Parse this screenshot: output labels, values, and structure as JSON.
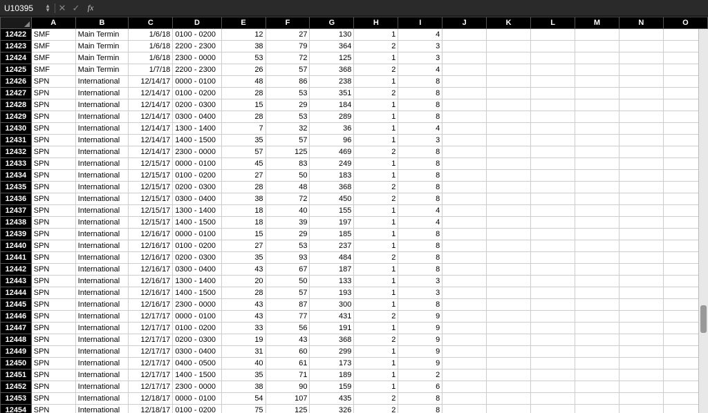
{
  "nameBox": "U10395",
  "fxLabel": "fx",
  "formula": "",
  "columns": [
    "A",
    "B",
    "C",
    "D",
    "E",
    "F",
    "G",
    "H",
    "I",
    "J",
    "K",
    "L",
    "M",
    "N",
    "O"
  ],
  "numericCols": [
    2,
    4,
    5,
    6,
    7,
    8
  ],
  "leftCols": [
    0,
    1,
    3
  ],
  "rows": [
    {
      "n": 12422,
      "c": [
        "SMF",
        "Main Termin",
        "1/6/18",
        "0100 - 0200",
        "12",
        "27",
        "130",
        "1",
        "4",
        "",
        "",
        "",
        "",
        "",
        ""
      ]
    },
    {
      "n": 12423,
      "c": [
        "SMF",
        "Main Termin",
        "1/6/18",
        "2200 - 2300",
        "38",
        "79",
        "364",
        "2",
        "3",
        "",
        "",
        "",
        "",
        "",
        ""
      ]
    },
    {
      "n": 12424,
      "c": [
        "SMF",
        "Main Termin",
        "1/6/18",
        "2300 - 0000",
        "53",
        "72",
        "125",
        "1",
        "3",
        "",
        "",
        "",
        "",
        "",
        ""
      ]
    },
    {
      "n": 12425,
      "c": [
        "SMF",
        "Main Termin",
        "1/7/18",
        "2200 - 2300",
        "26",
        "57",
        "368",
        "2",
        "4",
        "",
        "",
        "",
        "",
        "",
        ""
      ]
    },
    {
      "n": 12426,
      "c": [
        "SPN",
        "International",
        "12/14/17",
        "0000 - 0100",
        "48",
        "86",
        "238",
        "1",
        "8",
        "",
        "",
        "",
        "",
        "",
        ""
      ]
    },
    {
      "n": 12427,
      "c": [
        "SPN",
        "International",
        "12/14/17",
        "0100 - 0200",
        "28",
        "53",
        "351",
        "2",
        "8",
        "",
        "",
        "",
        "",
        "",
        ""
      ]
    },
    {
      "n": 12428,
      "c": [
        "SPN",
        "International",
        "12/14/17",
        "0200 - 0300",
        "15",
        "29",
        "184",
        "1",
        "8",
        "",
        "",
        "",
        "",
        "",
        ""
      ]
    },
    {
      "n": 12429,
      "c": [
        "SPN",
        "International",
        "12/14/17",
        "0300 - 0400",
        "28",
        "53",
        "289",
        "1",
        "8",
        "",
        "",
        "",
        "",
        "",
        ""
      ]
    },
    {
      "n": 12430,
      "c": [
        "SPN",
        "International",
        "12/14/17",
        "1300 - 1400",
        "7",
        "32",
        "36",
        "1",
        "4",
        "",
        "",
        "",
        "",
        "",
        ""
      ]
    },
    {
      "n": 12431,
      "c": [
        "SPN",
        "International",
        "12/14/17",
        "1400 - 1500",
        "35",
        "57",
        "96",
        "1",
        "3",
        "",
        "",
        "",
        "",
        "",
        ""
      ]
    },
    {
      "n": 12432,
      "c": [
        "SPN",
        "International",
        "12/14/17",
        "2300 - 0000",
        "57",
        "125",
        "469",
        "2",
        "8",
        "",
        "",
        "",
        "",
        "",
        ""
      ]
    },
    {
      "n": 12433,
      "c": [
        "SPN",
        "International",
        "12/15/17",
        "0000 - 0100",
        "45",
        "83",
        "249",
        "1",
        "8",
        "",
        "",
        "",
        "",
        "",
        ""
      ]
    },
    {
      "n": 12434,
      "c": [
        "SPN",
        "International",
        "12/15/17",
        "0100 - 0200",
        "27",
        "50",
        "183",
        "1",
        "8",
        "",
        "",
        "",
        "",
        "",
        ""
      ]
    },
    {
      "n": 12435,
      "c": [
        "SPN",
        "International",
        "12/15/17",
        "0200 - 0300",
        "28",
        "48",
        "368",
        "2",
        "8",
        "",
        "",
        "",
        "",
        "",
        ""
      ]
    },
    {
      "n": 12436,
      "c": [
        "SPN",
        "International",
        "12/15/17",
        "0300 - 0400",
        "38",
        "72",
        "450",
        "2",
        "8",
        "",
        "",
        "",
        "",
        "",
        ""
      ]
    },
    {
      "n": 12437,
      "c": [
        "SPN",
        "International",
        "12/15/17",
        "1300 - 1400",
        "18",
        "40",
        "155",
        "1",
        "4",
        "",
        "",
        "",
        "",
        "",
        ""
      ]
    },
    {
      "n": 12438,
      "c": [
        "SPN",
        "International",
        "12/15/17",
        "1400 - 1500",
        "18",
        "39",
        "197",
        "1",
        "4",
        "",
        "",
        "",
        "",
        "",
        ""
      ]
    },
    {
      "n": 12439,
      "c": [
        "SPN",
        "International",
        "12/16/17",
        "0000 - 0100",
        "15",
        "29",
        "185",
        "1",
        "8",
        "",
        "",
        "",
        "",
        "",
        ""
      ]
    },
    {
      "n": 12440,
      "c": [
        "SPN",
        "International",
        "12/16/17",
        "0100 - 0200",
        "27",
        "53",
        "237",
        "1",
        "8",
        "",
        "",
        "",
        "",
        "",
        ""
      ]
    },
    {
      "n": 12441,
      "c": [
        "SPN",
        "International",
        "12/16/17",
        "0200 - 0300",
        "35",
        "93",
        "484",
        "2",
        "8",
        "",
        "",
        "",
        "",
        "",
        ""
      ]
    },
    {
      "n": 12442,
      "c": [
        "SPN",
        "International",
        "12/16/17",
        "0300 - 0400",
        "43",
        "67",
        "187",
        "1",
        "8",
        "",
        "",
        "",
        "",
        "",
        ""
      ]
    },
    {
      "n": 12443,
      "c": [
        "SPN",
        "International",
        "12/16/17",
        "1300 - 1400",
        "20",
        "50",
        "133",
        "1",
        "3",
        "",
        "",
        "",
        "",
        "",
        ""
      ]
    },
    {
      "n": 12444,
      "c": [
        "SPN",
        "International",
        "12/16/17",
        "1400 - 1500",
        "28",
        "57",
        "193",
        "1",
        "3",
        "",
        "",
        "",
        "",
        "",
        ""
      ]
    },
    {
      "n": 12445,
      "c": [
        "SPN",
        "International",
        "12/16/17",
        "2300 - 0000",
        "43",
        "87",
        "300",
        "1",
        "8",
        "",
        "",
        "",
        "",
        "",
        ""
      ]
    },
    {
      "n": 12446,
      "c": [
        "SPN",
        "International",
        "12/17/17",
        "0000 - 0100",
        "43",
        "77",
        "431",
        "2",
        "9",
        "",
        "",
        "",
        "",
        "",
        ""
      ]
    },
    {
      "n": 12447,
      "c": [
        "SPN",
        "International",
        "12/17/17",
        "0100 - 0200",
        "33",
        "56",
        "191",
        "1",
        "9",
        "",
        "",
        "",
        "",
        "",
        ""
      ]
    },
    {
      "n": 12448,
      "c": [
        "SPN",
        "International",
        "12/17/17",
        "0200 - 0300",
        "19",
        "43",
        "368",
        "2",
        "9",
        "",
        "",
        "",
        "",
        "",
        ""
      ]
    },
    {
      "n": 12449,
      "c": [
        "SPN",
        "International",
        "12/17/17",
        "0300 - 0400",
        "31",
        "60",
        "299",
        "1",
        "9",
        "",
        "",
        "",
        "",
        "",
        ""
      ]
    },
    {
      "n": 12450,
      "c": [
        "SPN",
        "International",
        "12/17/17",
        "0400 - 0500",
        "40",
        "61",
        "173",
        "1",
        "9",
        "",
        "",
        "",
        "",
        "",
        ""
      ]
    },
    {
      "n": 12451,
      "c": [
        "SPN",
        "International",
        "12/17/17",
        "1400 - 1500",
        "35",
        "71",
        "189",
        "1",
        "2",
        "",
        "",
        "",
        "",
        "",
        ""
      ]
    },
    {
      "n": 12452,
      "c": [
        "SPN",
        "International",
        "12/17/17",
        "2300 - 0000",
        "38",
        "90",
        "159",
        "1",
        "6",
        "",
        "",
        "",
        "",
        "",
        ""
      ]
    },
    {
      "n": 12453,
      "c": [
        "SPN",
        "International",
        "12/18/17",
        "0000 - 0100",
        "54",
        "107",
        "435",
        "2",
        "8",
        "",
        "",
        "",
        "",
        "",
        ""
      ]
    },
    {
      "n": 12454,
      "c": [
        "SPN",
        "International",
        "12/18/17",
        "0100 - 0200",
        "75",
        "125",
        "326",
        "2",
        "8",
        "",
        "",
        "",
        "",
        "",
        ""
      ]
    }
  ]
}
